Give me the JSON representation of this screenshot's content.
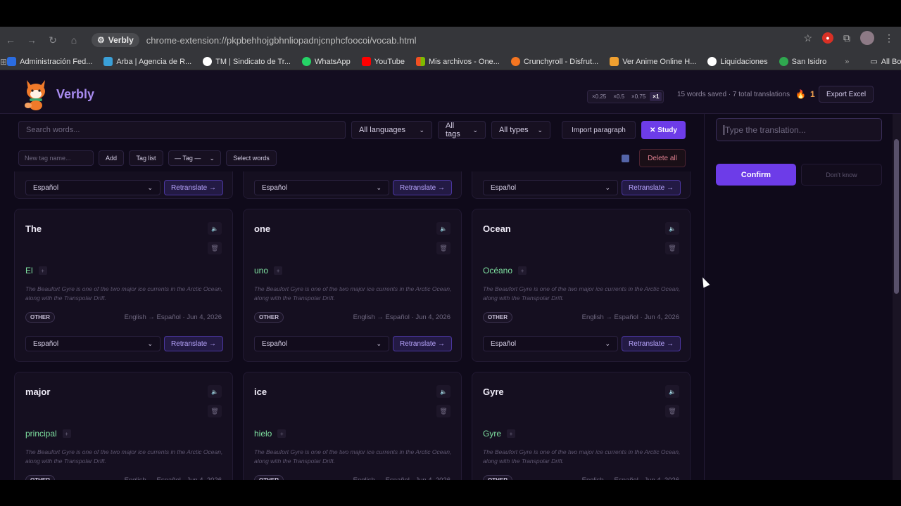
{
  "browser": {
    "site_name": "Verbly",
    "url": "chrome-extension://pkpbehhojgbhnliopadnjcnphcfoocoi/vocab.html",
    "bookmarks": [
      {
        "label": "Administración Fed...",
        "color": "#2b6ce0"
      },
      {
        "label": "Arba | Agencia de R...",
        "color": "#3aa0d8"
      },
      {
        "label": "TM | Sindicato de Tr...",
        "color": "#ffffff"
      },
      {
        "label": "WhatsApp",
        "color": "#25d366"
      },
      {
        "label": "YouTube",
        "color": "#ff0000"
      },
      {
        "label": "Mis archivos - One...",
        "color": "#f25022"
      },
      {
        "label": "Crunchyroll - Disfrut...",
        "color": "#f47521"
      },
      {
        "label": "Ver Anime Online H...",
        "color": "#f0a030"
      },
      {
        "label": "Liquidaciones",
        "color": "#ffffff"
      },
      {
        "label": "San Isidro",
        "color": "#2fa84f"
      }
    ],
    "all_bookmarks": "All Bookmarks",
    "more": "»"
  },
  "header": {
    "brand": "Verbly",
    "speeds": [
      "×0.25",
      "×0.5",
      "×0.75",
      "×1"
    ],
    "active_speed": "×1",
    "words_saved": "15 words saved · 7 total translations",
    "streak": "1",
    "export_label": "Export Excel"
  },
  "toolbar": {
    "search_placeholder": "Search words...",
    "languages": "All languages",
    "tags": "All tags",
    "types": "All types",
    "import_label": "Import paragraph",
    "study_label": "✕ Study",
    "tag_placeholder": "New tag name...",
    "add_label": "Add",
    "tag_list_label": "Tag list",
    "tag_select": "— Tag —",
    "select_words_label": "Select words",
    "delete_all_label": "Delete all"
  },
  "cards_common": {
    "context": "The Beaufort Gyre is one of the two major ice currents in the Arctic Ocean, along with the Transpolar Drift.",
    "type": "OTHER",
    "meta": "English → Español · Jun 4, 2026",
    "lang": "Español",
    "retranslate": "Retranslate →"
  },
  "cards": [
    {
      "word": "The",
      "translation": "El"
    },
    {
      "word": "one",
      "translation": "uno"
    },
    {
      "word": "Ocean",
      "translation": "Océano"
    },
    {
      "word": "major",
      "translation": "principal"
    },
    {
      "word": "ice",
      "translation": "hielo"
    },
    {
      "word": "Gyre",
      "translation": "Gyre"
    }
  ],
  "study": {
    "placeholder": "Type the translation...",
    "confirm_label": "Confirm",
    "dont_know_label": "Don't know"
  }
}
